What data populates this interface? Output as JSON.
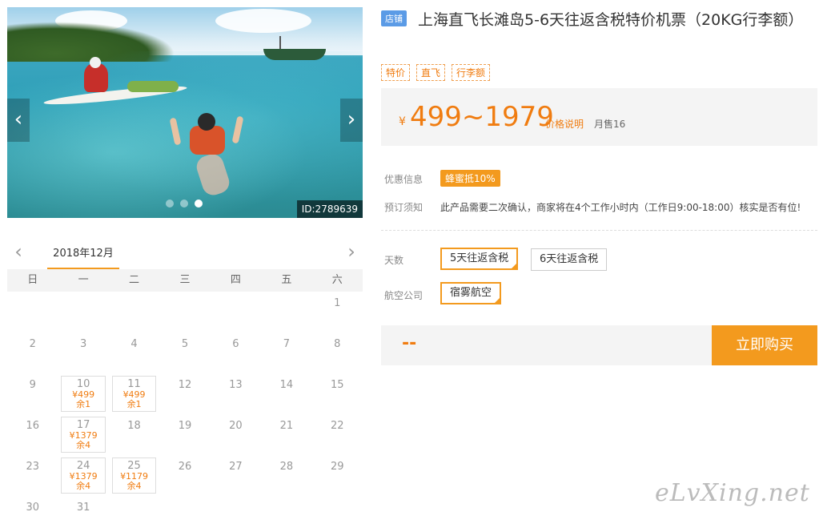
{
  "gallery": {
    "prev_arrow": "‹",
    "next_arrow": "›",
    "id_label": "ID:2789639",
    "slides": 3,
    "active_slide": 3
  },
  "calendar": {
    "prev_arrow": "‹",
    "next_arrow": "›",
    "month": "2018年12月",
    "weekdays": [
      "日",
      "一",
      "二",
      "三",
      "四",
      "五",
      "六"
    ],
    "cells": [
      {
        "day": ""
      },
      {
        "day": ""
      },
      {
        "day": ""
      },
      {
        "day": ""
      },
      {
        "day": ""
      },
      {
        "day": ""
      },
      {
        "day": "1"
      },
      {
        "day": "2"
      },
      {
        "day": "3"
      },
      {
        "day": "4"
      },
      {
        "day": "5"
      },
      {
        "day": "6"
      },
      {
        "day": "7"
      },
      {
        "day": "8"
      },
      {
        "day": "9"
      },
      {
        "day": "10",
        "price": "¥499",
        "stock": "余1"
      },
      {
        "day": "11",
        "price": "¥499",
        "stock": "余1"
      },
      {
        "day": "12"
      },
      {
        "day": "13"
      },
      {
        "day": "14"
      },
      {
        "day": "15"
      },
      {
        "day": "16"
      },
      {
        "day": "17",
        "price": "¥1379",
        "stock": "余4"
      },
      {
        "day": "18"
      },
      {
        "day": "19"
      },
      {
        "day": "20"
      },
      {
        "day": "21"
      },
      {
        "day": "22"
      },
      {
        "day": "23"
      },
      {
        "day": "24",
        "price": "¥1379",
        "stock": "余4"
      },
      {
        "day": "25",
        "price": "¥1179",
        "stock": "余4"
      },
      {
        "day": "26"
      },
      {
        "day": "27"
      },
      {
        "day": "28"
      },
      {
        "day": "29"
      },
      {
        "day": "30"
      },
      {
        "day": "31"
      }
    ]
  },
  "product": {
    "shop_badge": "店铺",
    "title": "上海直飞长滩岛5-6天往返含税特价机票（20KG行李额）",
    "tags": [
      "特价",
      "直飞",
      "行李额"
    ],
    "price_currency": "¥",
    "price_range": "499~1979",
    "price_note": "价格说明",
    "monthly_sales": "月售16",
    "promo_label": "优惠信息",
    "promo_badge": "蜂蜜抵10%",
    "notice_label": "预订须知",
    "notice_text": "此产品需要二次确认，商家将在4个工作小时内（工作日9:00-18:00）核实是否有位!",
    "days_label": "天数",
    "days_options": [
      "5天往返含税",
      "6天往返含税"
    ],
    "airline_label": "航空公司",
    "airline_options": [
      "宿雾航空"
    ],
    "selected_price": "--",
    "buy_button": "立即购买"
  },
  "watermark": "eLvXing.net",
  "colors": {
    "accent": "#f39a1e",
    "price": "#f07c10",
    "shop_badge": "#5b9be6"
  }
}
